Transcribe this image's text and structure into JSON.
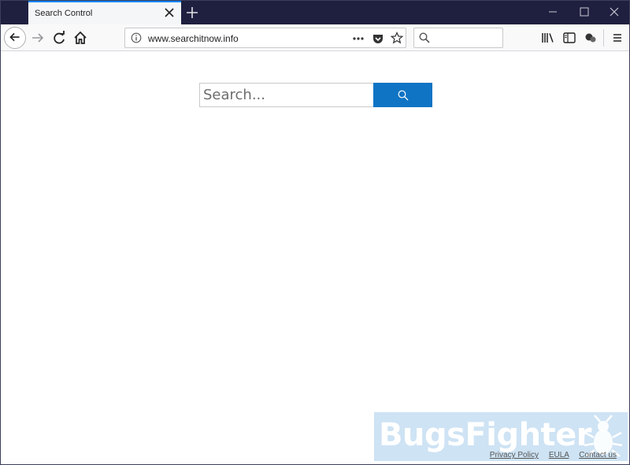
{
  "browser": {
    "tab": {
      "title": "Search Control"
    },
    "url": "www.searchitnow.info",
    "search_placeholder": ""
  },
  "page": {
    "search_placeholder": "Search...",
    "accent_color": "#0f74c4"
  },
  "watermark": {
    "text": "BugsFighter"
  },
  "footer": {
    "links": [
      "Privacy Policy",
      "EULA",
      "Contact us"
    ]
  }
}
